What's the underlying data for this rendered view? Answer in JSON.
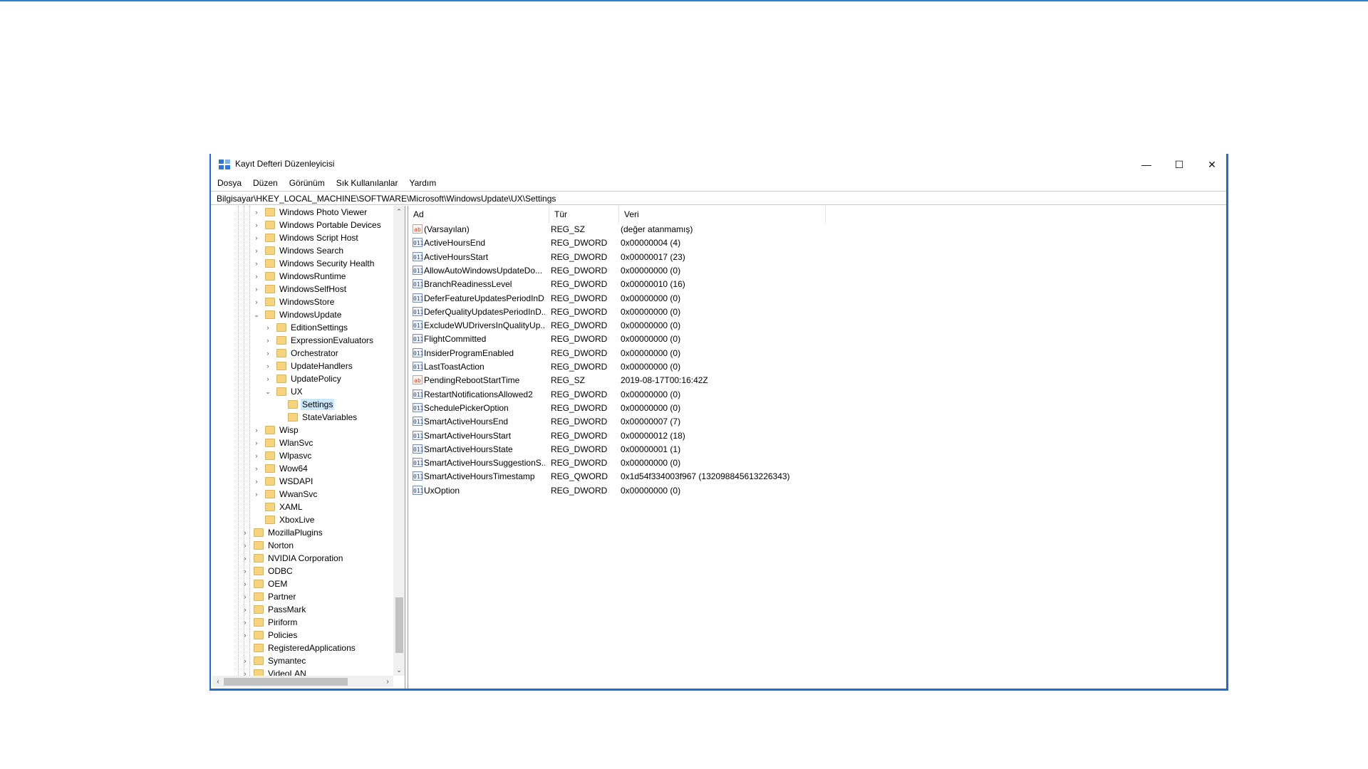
{
  "window": {
    "title": "Kayıt Defteri Düzenleyicisi",
    "controls": {
      "minimize": "—",
      "maximize": "☐",
      "close": "✕"
    }
  },
  "menu": [
    "Dosya",
    "Düzen",
    "Görünüm",
    "Sık Kullanılanlar",
    "Yardım"
  ],
  "address": "Bilgisayar\\HKEY_LOCAL_MACHINE\\SOFTWARE\\Microsoft\\WindowsUpdate\\UX\\Settings",
  "tree": [
    {
      "label": "Windows Photo Viewer",
      "level": 2,
      "expander": "collapsed"
    },
    {
      "label": "Windows Portable Devices",
      "level": 2,
      "expander": "collapsed"
    },
    {
      "label": "Windows Script Host",
      "level": 2,
      "expander": "collapsed"
    },
    {
      "label": "Windows Search",
      "level": 2,
      "expander": "collapsed"
    },
    {
      "label": "Windows Security Health",
      "level": 2,
      "expander": "collapsed"
    },
    {
      "label": "WindowsRuntime",
      "level": 2,
      "expander": "collapsed"
    },
    {
      "label": "WindowsSelfHost",
      "level": 2,
      "expander": "collapsed"
    },
    {
      "label": "WindowsStore",
      "level": 2,
      "expander": "collapsed"
    },
    {
      "label": "WindowsUpdate",
      "level": 2,
      "expander": "expanded"
    },
    {
      "label": "EditionSettings",
      "level": 3,
      "expander": "collapsed"
    },
    {
      "label": "ExpressionEvaluators",
      "level": 3,
      "expander": "collapsed"
    },
    {
      "label": "Orchestrator",
      "level": 3,
      "expander": "collapsed"
    },
    {
      "label": "UpdateHandlers",
      "level": 3,
      "expander": "collapsed"
    },
    {
      "label": "UpdatePolicy",
      "level": 3,
      "expander": "collapsed"
    },
    {
      "label": "UX",
      "level": 3,
      "expander": "expanded"
    },
    {
      "label": "Settings",
      "level": 4,
      "expander": "none",
      "selected": true
    },
    {
      "label": "StateVariables",
      "level": 4,
      "expander": "none"
    },
    {
      "label": "Wisp",
      "level": 2,
      "expander": "collapsed"
    },
    {
      "label": "WlanSvc",
      "level": 2,
      "expander": "collapsed"
    },
    {
      "label": "Wlpasvc",
      "level": 2,
      "expander": "collapsed"
    },
    {
      "label": "Wow64",
      "level": 2,
      "expander": "collapsed"
    },
    {
      "label": "WSDAPI",
      "level": 2,
      "expander": "collapsed"
    },
    {
      "label": "WwanSvc",
      "level": 2,
      "expander": "collapsed"
    },
    {
      "label": "XAML",
      "level": 2,
      "expander": "none"
    },
    {
      "label": "XboxLive",
      "level": 2,
      "expander": "none"
    },
    {
      "label": "MozillaPlugins",
      "level": 1,
      "expander": "collapsed"
    },
    {
      "label": "Norton",
      "level": 1,
      "expander": "collapsed"
    },
    {
      "label": "NVIDIA Corporation",
      "level": 1,
      "expander": "collapsed"
    },
    {
      "label": "ODBC",
      "level": 1,
      "expander": "collapsed"
    },
    {
      "label": "OEM",
      "level": 1,
      "expander": "collapsed"
    },
    {
      "label": "Partner",
      "level": 1,
      "expander": "collapsed"
    },
    {
      "label": "PassMark",
      "level": 1,
      "expander": "collapsed"
    },
    {
      "label": "Piriform",
      "level": 1,
      "expander": "collapsed"
    },
    {
      "label": "Policies",
      "level": 1,
      "expander": "collapsed"
    },
    {
      "label": "RegisteredApplications",
      "level": 1,
      "expander": "none"
    },
    {
      "label": "Symantec",
      "level": 1,
      "expander": "collapsed"
    },
    {
      "label": "VideoLAN",
      "level": 1,
      "expander": "collapsed"
    }
  ],
  "columns": {
    "name": "Ad",
    "type": "Tür",
    "data": "Veri"
  },
  "values": [
    {
      "icon": "string-value-icon",
      "icon_text": "ab",
      "name": "(Varsayılan)",
      "type": "REG_SZ",
      "data": "(değer atanmamış)"
    },
    {
      "icon": "binary-value-icon",
      "icon_text": "011",
      "name": "ActiveHoursEnd",
      "type": "REG_DWORD",
      "data": "0x00000004 (4)"
    },
    {
      "icon": "binary-value-icon",
      "icon_text": "011",
      "name": "ActiveHoursStart",
      "type": "REG_DWORD",
      "data": "0x00000017 (23)"
    },
    {
      "icon": "binary-value-icon",
      "icon_text": "011",
      "name": "AllowAutoWindowsUpdateDo...",
      "type": "REG_DWORD",
      "data": "0x00000000 (0)"
    },
    {
      "icon": "binary-value-icon",
      "icon_text": "011",
      "name": "BranchReadinessLevel",
      "type": "REG_DWORD",
      "data": "0x00000010 (16)"
    },
    {
      "icon": "binary-value-icon",
      "icon_text": "011",
      "name": "DeferFeatureUpdatesPeriodInD...",
      "type": "REG_DWORD",
      "data": "0x00000000 (0)"
    },
    {
      "icon": "binary-value-icon",
      "icon_text": "011",
      "name": "DeferQualityUpdatesPeriodInD...",
      "type": "REG_DWORD",
      "data": "0x00000000 (0)"
    },
    {
      "icon": "binary-value-icon",
      "icon_text": "011",
      "name": "ExcludeWUDriversInQualityUp...",
      "type": "REG_DWORD",
      "data": "0x00000000 (0)"
    },
    {
      "icon": "binary-value-icon",
      "icon_text": "011",
      "name": "FlightCommitted",
      "type": "REG_DWORD",
      "data": "0x00000000 (0)"
    },
    {
      "icon": "binary-value-icon",
      "icon_text": "011",
      "name": "InsiderProgramEnabled",
      "type": "REG_DWORD",
      "data": "0x00000000 (0)"
    },
    {
      "icon": "binary-value-icon",
      "icon_text": "011",
      "name": "LastToastAction",
      "type": "REG_DWORD",
      "data": "0x00000000 (0)"
    },
    {
      "icon": "string-value-icon",
      "icon_text": "ab",
      "name": "PendingRebootStartTime",
      "type": "REG_SZ",
      "data": "2019-08-17T00:16:42Z"
    },
    {
      "icon": "binary-value-icon",
      "icon_text": "011",
      "name": "RestartNotificationsAllowed2",
      "type": "REG_DWORD",
      "data": "0x00000000 (0)"
    },
    {
      "icon": "binary-value-icon",
      "icon_text": "011",
      "name": "SchedulePickerOption",
      "type": "REG_DWORD",
      "data": "0x00000000 (0)"
    },
    {
      "icon": "binary-value-icon",
      "icon_text": "011",
      "name": "SmartActiveHoursEnd",
      "type": "REG_DWORD",
      "data": "0x00000007 (7)"
    },
    {
      "icon": "binary-value-icon",
      "icon_text": "011",
      "name": "SmartActiveHoursStart",
      "type": "REG_DWORD",
      "data": "0x00000012 (18)"
    },
    {
      "icon": "binary-value-icon",
      "icon_text": "011",
      "name": "SmartActiveHoursState",
      "type": "REG_DWORD",
      "data": "0x00000001 (1)"
    },
    {
      "icon": "binary-value-icon",
      "icon_text": "011",
      "name": "SmartActiveHoursSuggestionS...",
      "type": "REG_DWORD",
      "data": "0x00000000 (0)"
    },
    {
      "icon": "binary-value-icon",
      "icon_text": "011",
      "name": "SmartActiveHoursTimestamp",
      "type": "REG_QWORD",
      "data": "0x1d54f334003f967 (132098845613226343)"
    },
    {
      "icon": "binary-value-icon",
      "icon_text": "011",
      "name": "UxOption",
      "type": "REG_DWORD",
      "data": "0x00000000 (0)"
    }
  ],
  "scrollbar": {
    "up": "⌃",
    "down": "⌄",
    "left": "‹",
    "right": "›"
  },
  "colors": {
    "accent": "#1e6fd0",
    "selection": "#cce8ff",
    "folder": "#f5d47b"
  }
}
